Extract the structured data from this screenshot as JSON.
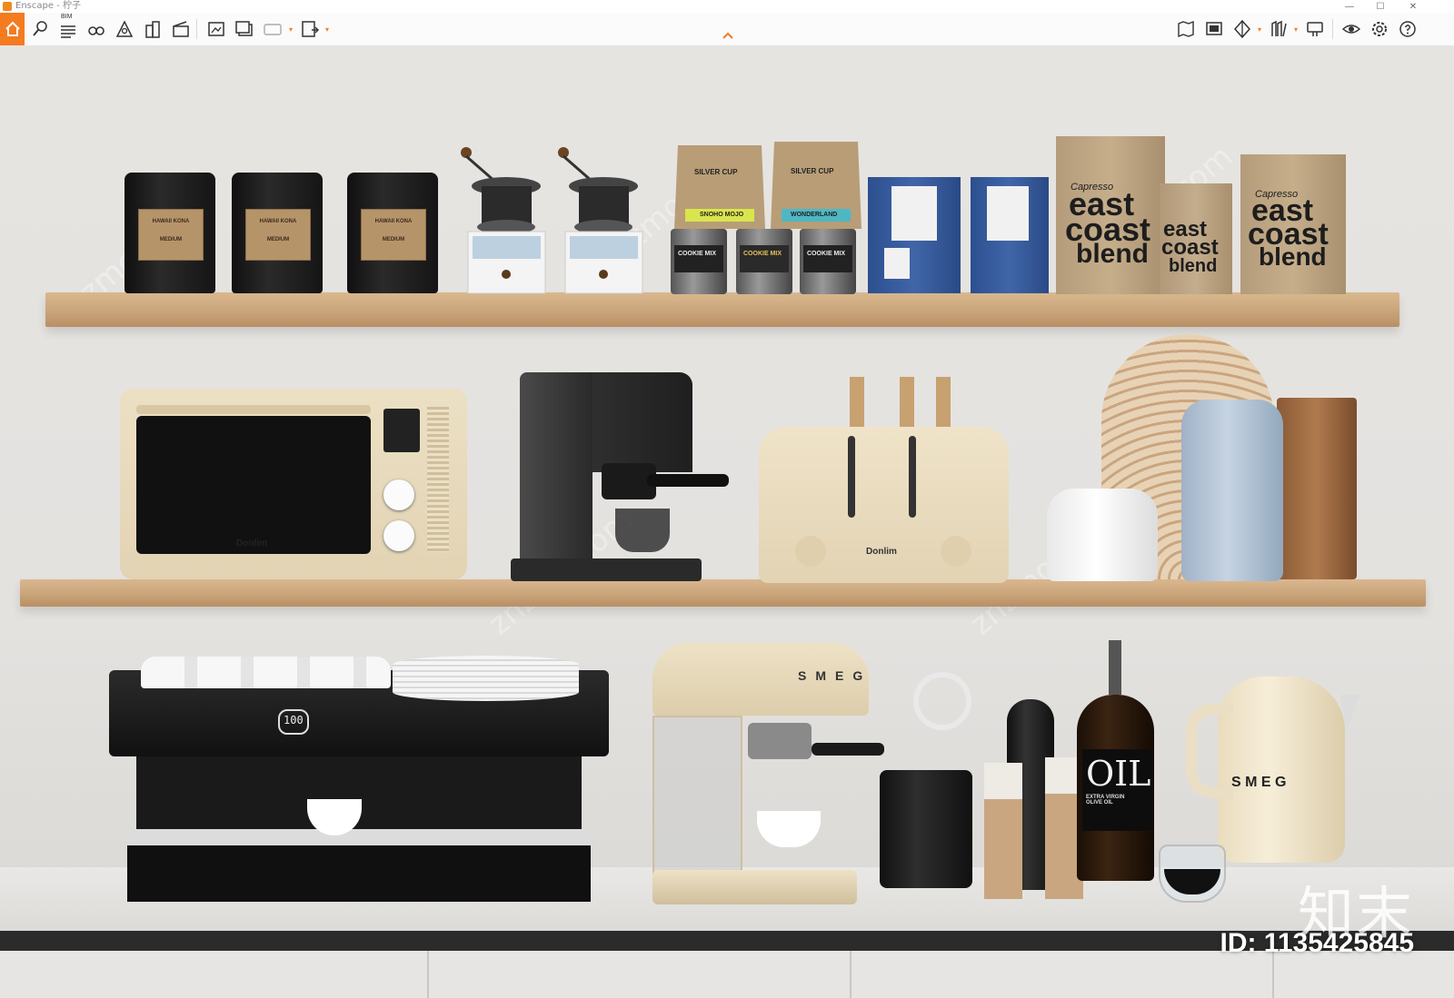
{
  "window": {
    "title": "Enscape - 柠子"
  },
  "toolbar": {
    "bim_label": "BIM",
    "icons": [
      "home-icon",
      "asset-pin-icon",
      "bim-list-icon",
      "binoculars-icon",
      "project-icon",
      "buildings-icon",
      "clapper-icon",
      "export-image-icon",
      "batch-export-icon",
      "panorama-icon",
      "exe-export-icon",
      "map-icon",
      "screen-icon",
      "cube-icon",
      "library-icon",
      "collaborate-icon",
      "visibility-icon",
      "settings-icon",
      "help-icon"
    ]
  },
  "scene": {
    "tins_label_title": "HAWAII KONA",
    "tins_label_sub": "MEDIUM",
    "bag1_title": "SILVER CUP",
    "bag1_sub": "SNOHO MOJO",
    "bag2_title": "SILVER CUP",
    "bag2_sub": "WONDERLAND",
    "jar_label": "COOKIE MIX",
    "kraft_brand": "Capresso",
    "kraft_text_1": "east",
    "kraft_text_2": "coast",
    "kraft_text_3": "blend",
    "oven_brand": "Donlim",
    "toaster_brand": "Donlim",
    "espresso_display": "100",
    "smeg_machine_text": "SMEG",
    "kettle_text": "S M E G",
    "oil_text": "OIL",
    "oil_sub": "EXTRA VIRGIN OLIVE OIL",
    "watermark": "知末",
    "id_text": "ID: 1135425845"
  },
  "colors": {
    "accent": "#f47b20",
    "wall": "#e6e4e1",
    "shelf": "#caa47a",
    "cream": "#efe3c8",
    "black": "#1f1f1f"
  }
}
